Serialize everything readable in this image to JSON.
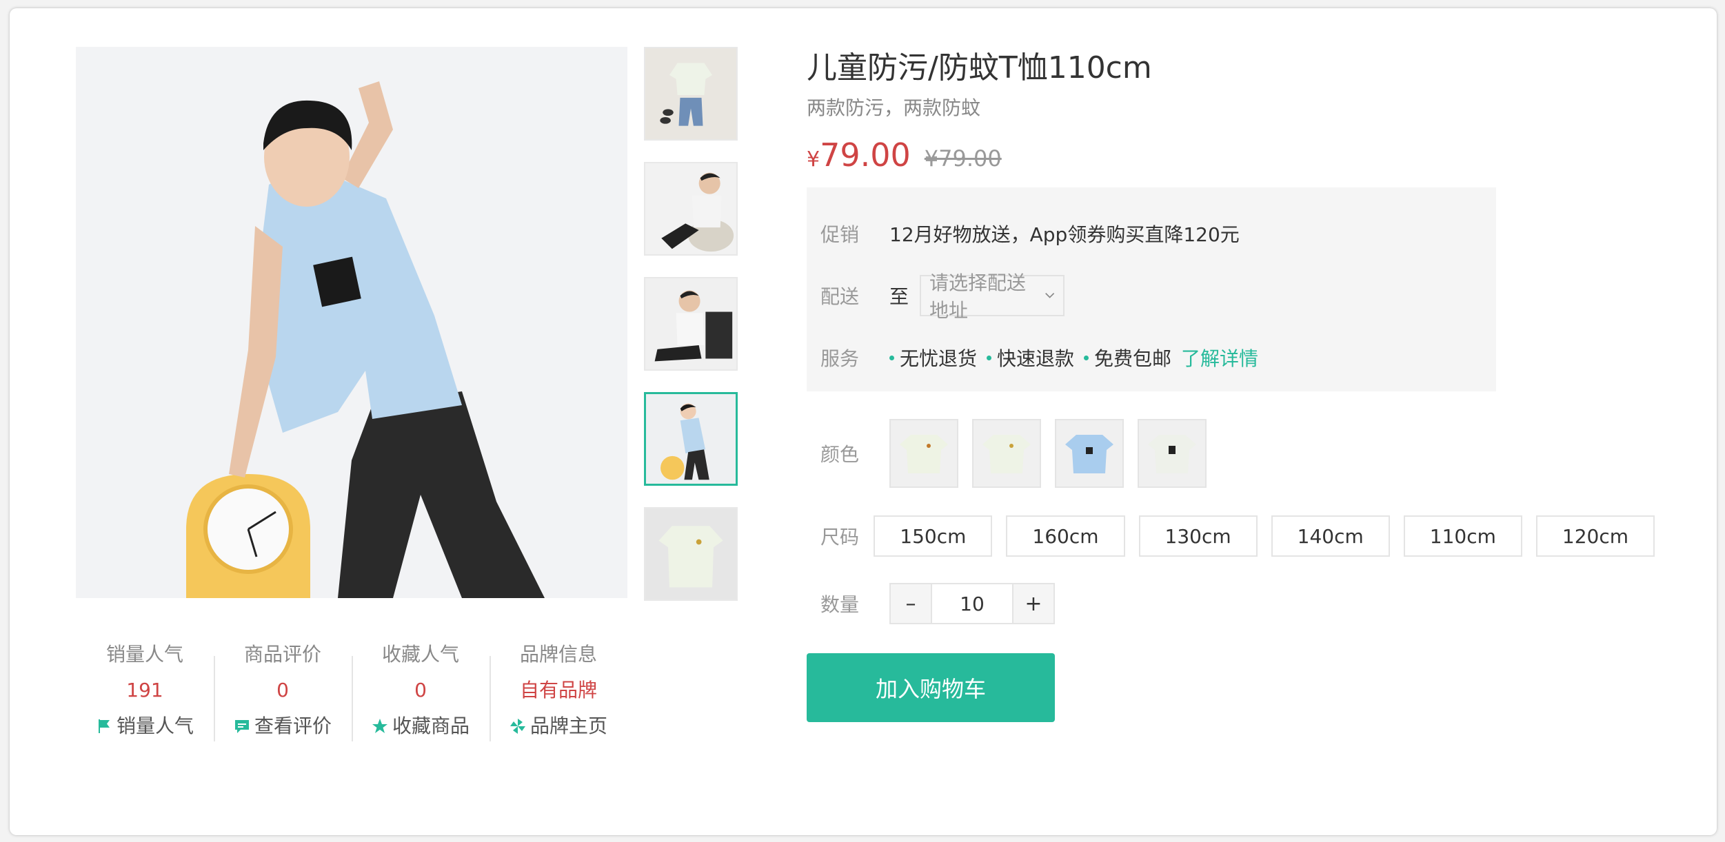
{
  "product": {
    "title": "儿童防污/防蚊T恤110cm",
    "desc": "两款防污，两款防蚊",
    "price_symbol": "¥",
    "price": "79.00",
    "old_price": "¥79.00"
  },
  "promo": {
    "promo_label": "促销",
    "promo_text": "12月好物放送，App领券购买直降120元",
    "delivery_label": "配送",
    "delivery_to": "至",
    "address_placeholder": "请选择配送地址",
    "service_label": "服务",
    "services": [
      "无忧退货",
      "快速退款",
      "免费包邮"
    ],
    "service_more": "了解详情"
  },
  "specs": {
    "color_label": "颜色",
    "size_label": "尺码",
    "sizes": [
      "150cm",
      "160cm",
      "130cm",
      "140cm",
      "110cm",
      "120cm"
    ],
    "qty_label": "数量",
    "qty_minus": "–",
    "qty_plus": "+",
    "qty_value": "10"
  },
  "cart_button": "加入购物车",
  "stats": [
    {
      "title": "销量人气",
      "value": "191",
      "link": "销量人气",
      "icon": "flag-icon"
    },
    {
      "title": "商品评价",
      "value": "0",
      "link": "查看评价",
      "icon": "comment-icon"
    },
    {
      "title": "收藏人气",
      "value": "0",
      "link": "收藏商品",
      "icon": "star-icon"
    },
    {
      "title": "品牌信息",
      "value": "自有品牌",
      "link": "品牌主页",
      "icon": "pinwheel-icon"
    }
  ],
  "colors": {
    "accent": "#27ba9b",
    "price": "#cf4444"
  }
}
